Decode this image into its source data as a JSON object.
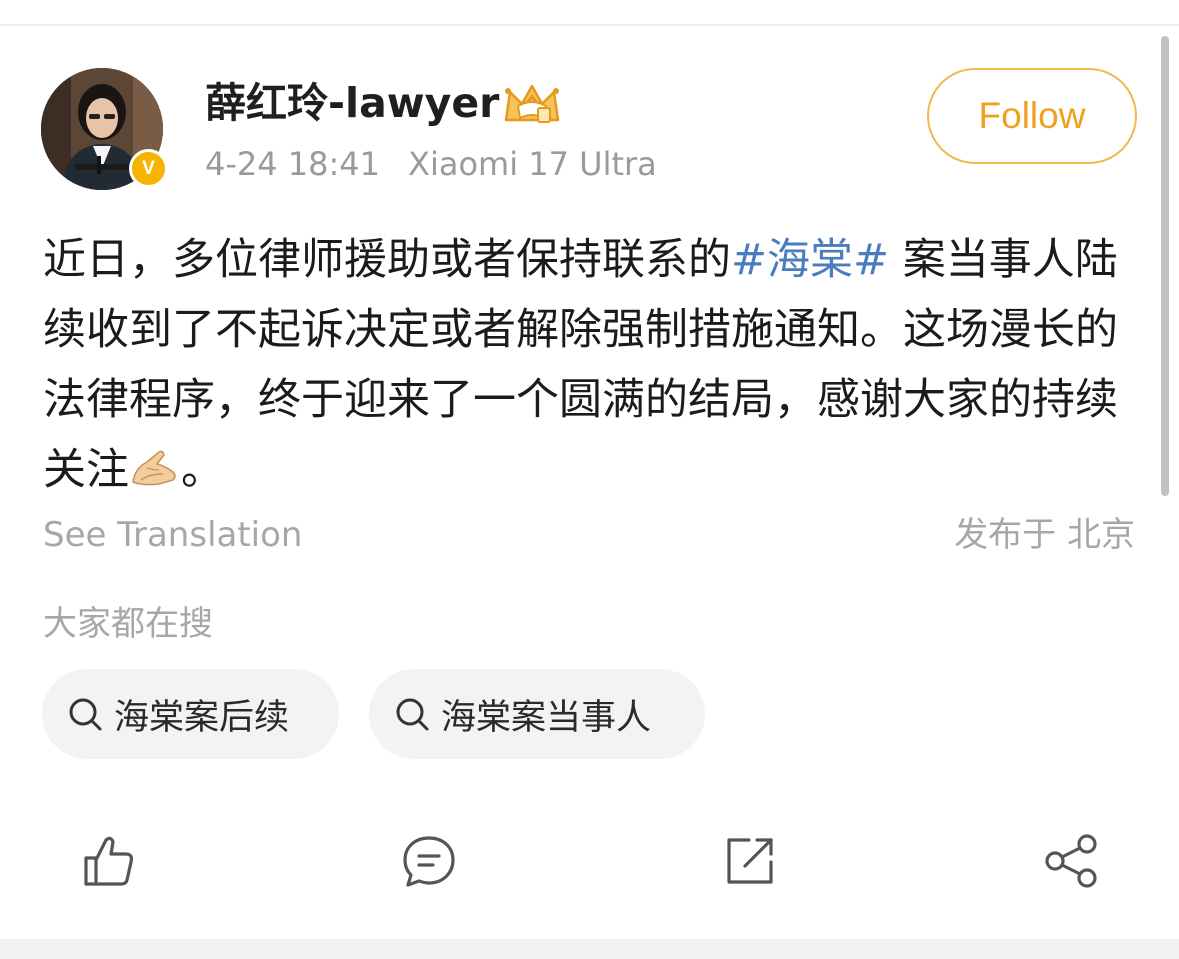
{
  "post": {
    "username": "薛红玲-lawyer",
    "timestamp": "4-24 18:41",
    "device": "Xiaomi 17 Ultra",
    "verified_badge": "V",
    "follow_label": "Follow",
    "content": {
      "part1": "近日，多位律师援助或者保持联系的",
      "hashtag": "#海棠#",
      "part2": " 案当事人陆续收到了不起诉决定或者解除强制措施通知。这场漫长的法律程序，终于迎来了一个圆满的结局，感谢大家的持续关注",
      "end": "。"
    },
    "see_translation": "See Translation",
    "location": "发布于 北京"
  },
  "search": {
    "heading": "大家都在搜",
    "chips": [
      {
        "label": "海棠案后续"
      },
      {
        "label": "海棠案当事人"
      }
    ]
  },
  "actions": [
    {
      "name": "like",
      "icon": "thumbs-up-icon"
    },
    {
      "name": "comment",
      "icon": "comment-icon"
    },
    {
      "name": "repost",
      "icon": "repost-icon"
    },
    {
      "name": "share",
      "icon": "share-icon"
    }
  ],
  "colors": {
    "accent": "#f0a020",
    "hashtag": "#4a7cbf",
    "muted": "#a7a7a7",
    "verified": "#f5b400"
  }
}
